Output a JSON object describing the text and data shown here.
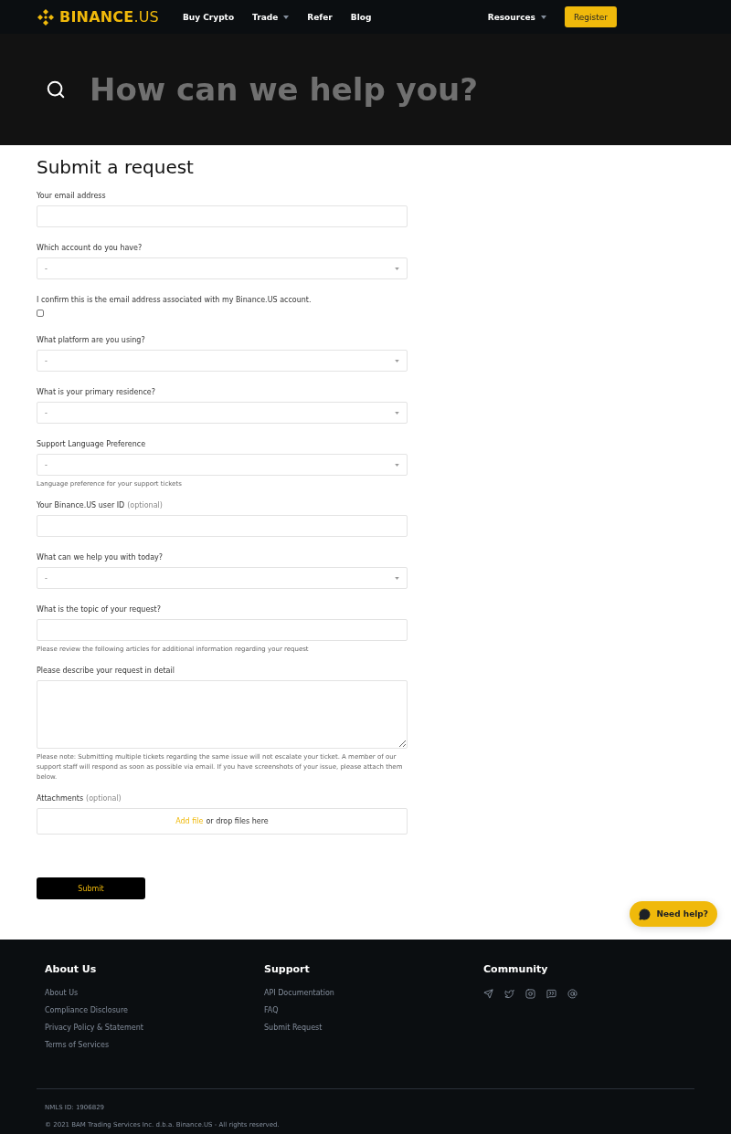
{
  "nav": {
    "brand": "BINANCE",
    "brand_suffix": ".US",
    "items": [
      {
        "label": "Buy Crypto",
        "dropdown": false
      },
      {
        "label": "Trade",
        "dropdown": true
      },
      {
        "label": "Refer",
        "dropdown": false
      },
      {
        "label": "Blog",
        "dropdown": false
      }
    ],
    "right_items": [
      {
        "label": "Resources",
        "dropdown": true
      }
    ],
    "register": "Register"
  },
  "hero": {
    "placeholder": "How can we help you?"
  },
  "form": {
    "title": "Submit a request",
    "fields": [
      {
        "kind": "text",
        "label": "Your email address"
      },
      {
        "kind": "select",
        "label": "Which account do you have?",
        "value": "-"
      },
      {
        "kind": "checkbox",
        "label": "I confirm this is the email address associated with my Binance.US account.",
        "checked": false
      },
      {
        "kind": "select",
        "label": "What platform are you using?",
        "value": "-"
      },
      {
        "kind": "select",
        "label": "What is your primary residence?",
        "value": "-"
      },
      {
        "kind": "select",
        "label": "Support Language Preference",
        "value": "-",
        "hint": "Language preference for your support tickets"
      },
      {
        "kind": "text",
        "label": "Your Binance.US user ID",
        "optional": "(optional)"
      },
      {
        "kind": "select",
        "label": "What can we help you with today?",
        "value": "-"
      },
      {
        "kind": "text",
        "label": "What is the topic of your request?",
        "hint": "Please review the following articles for additional information regarding your request"
      },
      {
        "kind": "textarea",
        "label": "Please describe your request in detail",
        "hint": "Please note: Submitting multiple tickets regarding the same issue will not escalate your ticket. A member of our support staff will respond as soon as possible via email. If you have screenshots of your issue, please attach them below."
      },
      {
        "kind": "file",
        "label": "Attachments",
        "optional": "(optional)",
        "link": "Add file",
        "text": "or drop files here"
      }
    ],
    "submit": "Submit"
  },
  "help_button": "Need help?",
  "footer": {
    "columns": [
      {
        "title": "About Us",
        "links": [
          "About Us",
          "Compliance Disclosure",
          "Privacy Policy & Statement",
          "Terms of Services"
        ]
      },
      {
        "title": "Support",
        "links": [
          "API Documentation",
          "FAQ",
          "Submit Request"
        ]
      },
      {
        "title": "Community",
        "socials": true
      }
    ],
    "nmls": "NMLS ID: 1906829",
    "copyright": "© 2021 BAM Trading Services Inc. d.b.a. Binance.US - All rights reserved."
  }
}
